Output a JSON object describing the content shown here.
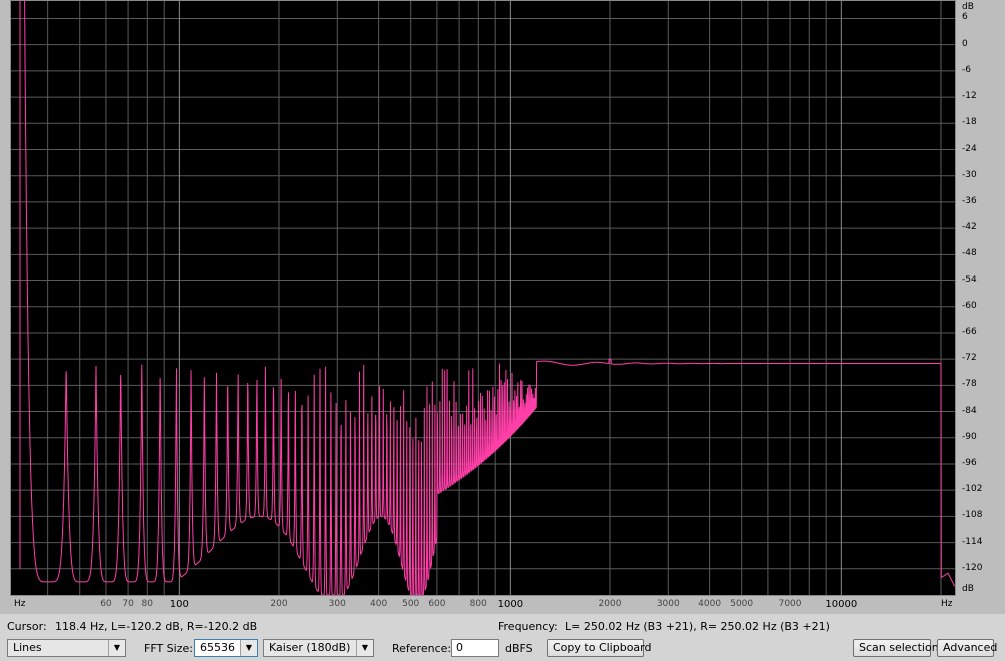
{
  "plot": {
    "x_unit": "Hz",
    "y_unit": "dB",
    "y_ticks": [
      "6",
      "0",
      "-6",
      "-12",
      "-18",
      "-24",
      "-30",
      "-36",
      "-42",
      "-48",
      "-54",
      "-60",
      "-66",
      "-72",
      "-78",
      "-84",
      "-90",
      "-96",
      "-102",
      "-108",
      "-114",
      "-120"
    ],
    "x_major_ticks": [
      {
        "value": 100,
        "label": "100"
      },
      {
        "value": 1000,
        "label": "1000"
      },
      {
        "value": 10000,
        "label": "10000"
      }
    ],
    "x_minor_ticks": [
      {
        "value": 60,
        "label": "60"
      },
      {
        "value": 70,
        "label": "70"
      },
      {
        "value": 80,
        "label": "80"
      },
      {
        "value": 200,
        "label": "200"
      },
      {
        "value": 300,
        "label": "300"
      },
      {
        "value": 400,
        "label": "400"
      },
      {
        "value": 500,
        "label": "500"
      },
      {
        "value": 600,
        "label": "600"
      },
      {
        "value": 800,
        "label": "800"
      },
      {
        "value": 2000,
        "label": "2000"
      },
      {
        "value": 3000,
        "label": "3000"
      },
      {
        "value": 4000,
        "label": "4000"
      },
      {
        "value": 5000,
        "label": "5000"
      },
      {
        "value": 7000,
        "label": "7000"
      }
    ],
    "x_range_hz": [
      31,
      22050
    ],
    "y_range_db": [
      -126,
      10
    ],
    "grid": true,
    "colors": {
      "background": "#000000",
      "grid": "#5a5a5a",
      "trace": "#ff3fa8"
    }
  },
  "chart_data": {
    "type": "line",
    "xlabel": "Hz",
    "ylabel": "dB",
    "x_scale": "log",
    "xlim": [
      31,
      22050
    ],
    "ylim": [
      -126,
      10
    ],
    "grid": true,
    "series": [
      {
        "x": [
          33,
          35,
          45,
          60,
          80,
          100,
          150,
          200,
          300,
          400,
          500,
          600,
          700,
          800,
          900,
          1000,
          1200,
          1500,
          2000,
          3000,
          5000,
          10000,
          20000,
          20500,
          21000
        ],
        "y": [
          -120,
          -73,
          -73,
          -73,
          -73,
          -73,
          -73,
          -73,
          -73,
          -73,
          -73,
          -73,
          -73,
          -73,
          -73,
          -73,
          -73,
          -73,
          -72,
          -73,
          -73,
          -73,
          -73,
          -122,
          -122
        ]
      }
    ]
  },
  "status": {
    "cursor_label": "Cursor:",
    "cursor_value": "118.4 Hz, L=-120.2 dB, R=-120.2 dB",
    "frequency_label": "Frequency:",
    "frequency_value": "L= 250.02 Hz (B3 +21), R= 250.02 Hz (B3 +21)"
  },
  "toolbar": {
    "view_mode": "Lines",
    "fft_size_label": "FFT Size:",
    "fft_size": "65536",
    "window": "Kaiser (180dB)",
    "reference_label": "Reference:",
    "reference_value": "0",
    "reference_unit": "dBFS",
    "copy_button": "Copy to Clipboard",
    "scan_button": "Scan selection",
    "advanced_button": "Advanced"
  }
}
